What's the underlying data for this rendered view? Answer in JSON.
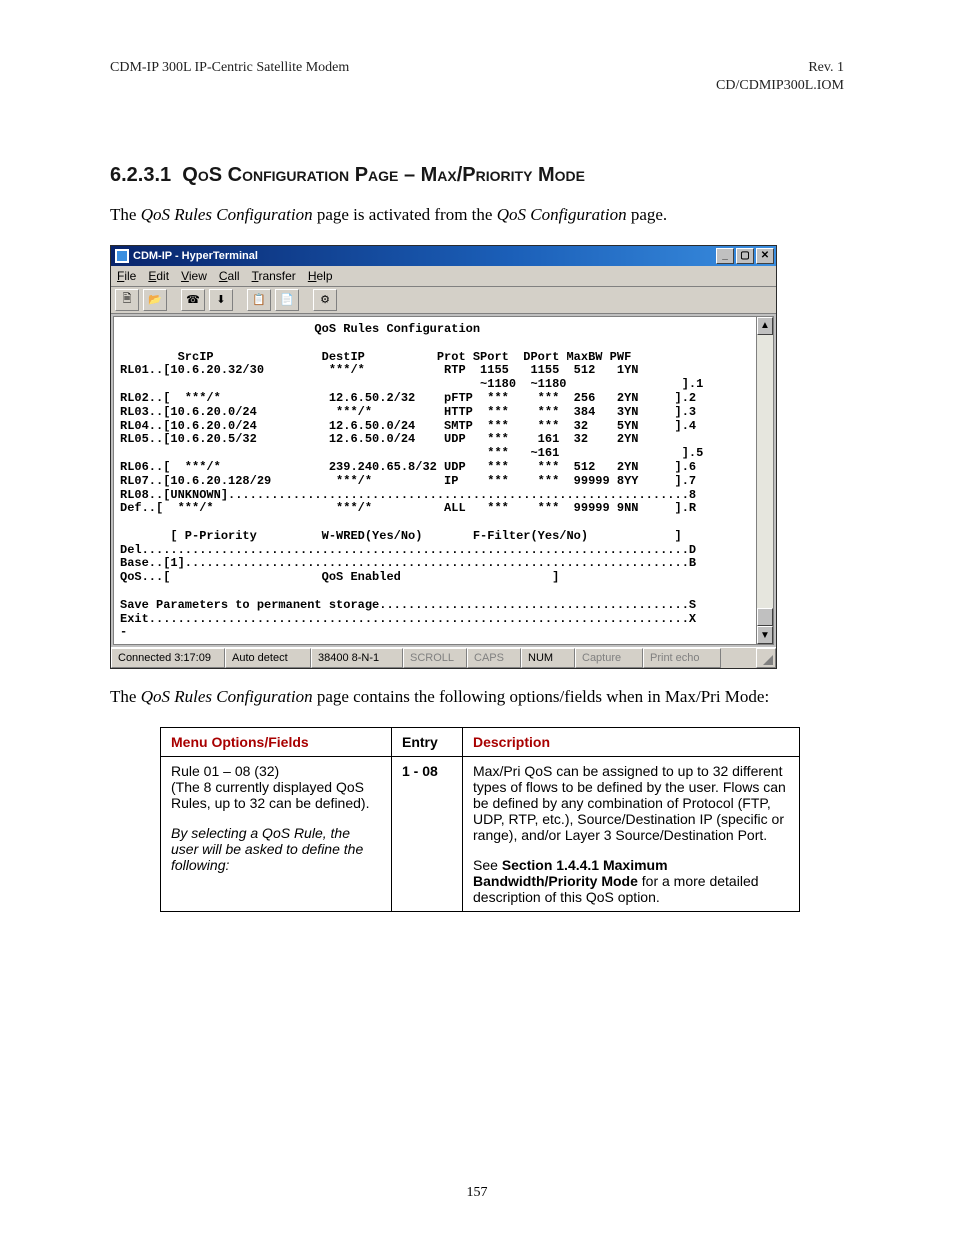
{
  "header": {
    "left": "CDM-IP 300L IP-Centric Satellite Modem",
    "right_line1": "Rev. 1",
    "right_line2": "CD/CDMIP300L.IOM"
  },
  "heading": {
    "num": "6.2.3.1",
    "text": "QoS Configuration Page – Max/Priority Mode"
  },
  "intro": {
    "pre": "The ",
    "em1": "QoS Rules Configuration",
    "mid": " page is activated from the ",
    "em2": "QoS Configuration",
    "post": " page."
  },
  "window": {
    "title": "CDM-IP - HyperTerminal",
    "menus": [
      "File",
      "Edit",
      "View",
      "Call",
      "Transfer",
      "Help"
    ],
    "toolbar_icons": [
      "new-icon",
      "open-icon",
      "hangup-icon",
      "receive-icon",
      "send-icon",
      "copy-icon",
      "properties-icon"
    ]
  },
  "terminal": {
    "title": "QoS Rules Configuration",
    "col_headers": "        SrcIP               DestIP          Prot SPort  DPort MaxBW PWF",
    "lines": [
      "RL01..[10.6.20.32/30         ***/*           RTP  1155   1155  512   1YN",
      "                                                  ~1180  ~1180                ].1",
      "RL02..[  ***/*               12.6.50.2/32    pFTP  ***    ***  256   2YN     ].2",
      "RL03..[10.6.20.0/24           ***/*          HTTP  ***    ***  384   3YN     ].3",
      "RL04..[10.6.20.0/24          12.6.50.0/24    SMTP  ***    ***  32    5YN     ].4",
      "RL05..[10.6.20.5/32          12.6.50.0/24    UDP   ***    161  32    2YN",
      "                                                   ***   ~161                 ].5",
      "RL06..[  ***/*               239.240.65.8/32 UDP   ***    ***  512   2YN     ].6",
      "RL07..[10.6.20.128/29         ***/*          IP    ***    ***  99999 8YY     ].7",
      "RL08..[UNKNOWN]................................................................8",
      "Def..[  ***/*                 ***/*          ALL   ***    ***  99999 9NN     ].R",
      "",
      "       [ P-Priority         W-WRED(Yes/No)       F-Filter(Yes/No)            ]",
      "Del............................................................................D",
      "Base..[1]......................................................................B",
      "QoS...[                     QoS Enabled                     ]",
      "",
      "Save Parameters to permanent storage...........................................S",
      "Exit...........................................................................X",
      "-"
    ]
  },
  "statusbar": {
    "connected": "Connected 3:17:09",
    "detect": "Auto detect",
    "settings": "38400 8-N-1",
    "scroll": "SCROLL",
    "caps": "CAPS",
    "num": "NUM",
    "capture": "Capture",
    "printecho": "Print echo"
  },
  "after_text": {
    "pre": "The ",
    "em1": "QoS Rules Configuration",
    "post": " page contains the following options/fields when in Max/Pri Mode:"
  },
  "table": {
    "headers": [
      "Menu Options/Fields",
      "Entry",
      "Description"
    ],
    "row1": {
      "menu_l1": "Rule 01 – 08 (32)",
      "menu_l2": "(The 8 currently displayed QoS Rules, up to 32 can be defined).",
      "menu_ital": "By selecting a QoS Rule, the user will be asked to define the following:",
      "entry": "1 - 08",
      "desc1": "Max/Pri QoS can be assigned to up to 32 different types of flows to be defined by the user.  Flows can be defined by any combination of Protocol (FTP, UDP, RTP, etc.), Source/Destination IP (specific or range), and/or Layer 3 Source/Destination Port.",
      "desc2_pre": "See ",
      "desc2_bold": "Section 1.4.4.1 Maximum Bandwidth/Priority Mode",
      "desc2_post": " for a more detailed description of this QoS option."
    }
  },
  "page_number": "157"
}
